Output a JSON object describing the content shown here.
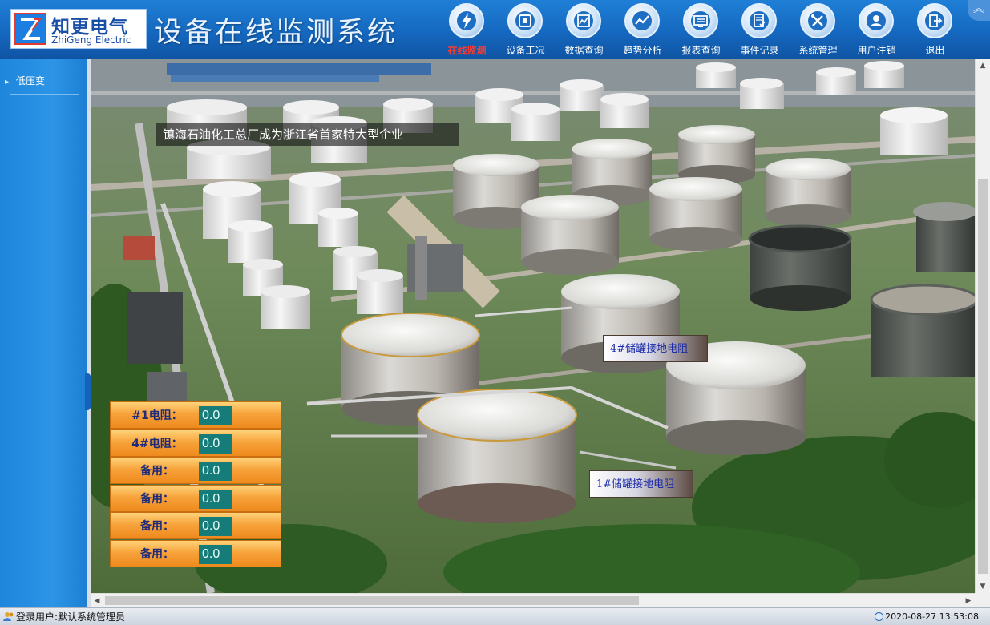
{
  "header": {
    "logo_cn": "知更电气",
    "logo_en": "ZhiGeng Electric",
    "title": "设备在线监测系统",
    "nav": [
      {
        "label": "在线监测",
        "icon": "lightning-icon",
        "active": true
      },
      {
        "label": "设备工况",
        "icon": "equipment-icon",
        "active": false
      },
      {
        "label": "数据查询",
        "icon": "data-query-icon",
        "active": false
      },
      {
        "label": "趋势分析",
        "icon": "trend-chart-icon",
        "active": false
      },
      {
        "label": "报表查询",
        "icon": "report-icon",
        "active": false
      },
      {
        "label": "事件记录",
        "icon": "event-log-icon",
        "active": false
      },
      {
        "label": "系统管理",
        "icon": "tools-icon",
        "active": false
      },
      {
        "label": "用户注销",
        "icon": "user-icon",
        "active": false
      },
      {
        "label": "退出",
        "icon": "exit-icon",
        "active": false
      }
    ],
    "collapse_glyph": "︽"
  },
  "sidebar": {
    "items": [
      {
        "label": "低压变"
      }
    ]
  },
  "scene": {
    "banner": "镇海石油化工总厂成为浙江省首家特大型企业",
    "tank_labels": {
      "tank4": "4#储罐接地电阻",
      "tank1": "1#储罐接地电阻"
    },
    "readings": [
      {
        "label": "#1电阻：",
        "value": "0.0"
      },
      {
        "label": "4#电阻：",
        "value": "0.0"
      },
      {
        "label": "备用：",
        "value": "0.0"
      },
      {
        "label": "备用：",
        "value": "0.0"
      },
      {
        "label": "备用：",
        "value": "0.0"
      },
      {
        "label": "备用：",
        "value": "0.0"
      }
    ]
  },
  "status": {
    "user": "登录用户:默认系统管理员",
    "datetime": "2020-08-27 13:53:08"
  },
  "colors": {
    "header_blue": "#1568bf",
    "active_nav": "#ff3b2f",
    "reading_orange": "#f7a33c",
    "value_teal": "#157c7a"
  }
}
